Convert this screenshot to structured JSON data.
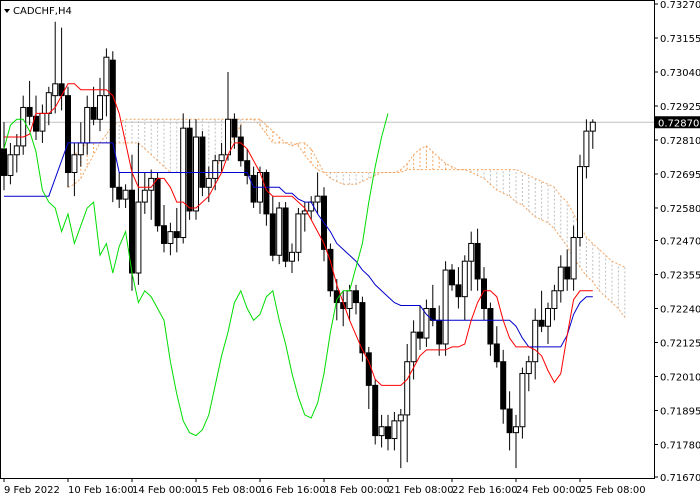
{
  "chart_data": {
    "type": "candlestick",
    "symbol_label": "CADCHF,H4",
    "current_price": "0.72870",
    "ylim": [
      0.7167,
      0.7327
    ],
    "y_ticks": [
      "0.73270",
      "0.73155",
      "0.73040",
      "0.72925",
      "0.72810",
      "0.72695",
      "0.72580",
      "0.72470",
      "0.72355",
      "0.72240",
      "0.72125",
      "0.72010",
      "0.71895",
      "0.71780",
      "0.71670"
    ],
    "x_ticks": [
      "9 Feb 2022",
      "10 Feb 16:00",
      "14 Feb 00:00",
      "15 Feb 08:00",
      "16 Feb 16:00",
      "18 Feb 00:00",
      "21 Feb 08:00",
      "22 Feb 16:00",
      "24 Feb 00:00",
      "25 Feb 08:00"
    ],
    "x_tick_index": [
      0,
      10,
      20,
      30,
      40,
      50,
      60,
      70,
      80,
      90
    ],
    "candles": [
      [
        0.7278,
        0.7287,
        0.7264,
        0.7269
      ],
      [
        0.7269,
        0.728,
        0.7266,
        0.7276
      ],
      [
        0.7276,
        0.7283,
        0.727,
        0.7279
      ],
      [
        0.7279,
        0.7296,
        0.7276,
        0.7292
      ],
      [
        0.7292,
        0.7301,
        0.7286,
        0.7289
      ],
      [
        0.7289,
        0.7296,
        0.7281,
        0.7284
      ],
      [
        0.7284,
        0.7293,
        0.728,
        0.729
      ],
      [
        0.729,
        0.7299,
        0.7286,
        0.7297
      ],
      [
        0.7296,
        0.7321,
        0.729,
        0.73
      ],
      [
        0.73,
        0.7319,
        0.7291,
        0.7296
      ],
      [
        0.7296,
        0.7299,
        0.7265,
        0.727
      ],
      [
        0.727,
        0.728,
        0.7262,
        0.7276
      ],
      [
        0.7276,
        0.7287,
        0.7272,
        0.728
      ],
      [
        0.728,
        0.7296,
        0.7276,
        0.7292
      ],
      [
        0.7292,
        0.7299,
        0.7286,
        0.7288
      ],
      [
        0.7288,
        0.7302,
        0.7284,
        0.7296
      ],
      [
        0.7296,
        0.7312,
        0.7289,
        0.7309
      ],
      [
        0.7308,
        0.7311,
        0.726,
        0.7265
      ],
      [
        0.7265,
        0.727,
        0.7258,
        0.7261
      ],
      [
        0.7261,
        0.7266,
        0.7258,
        0.7264
      ],
      [
        0.7264,
        0.7276,
        0.723,
        0.7236
      ],
      [
        0.7236,
        0.728,
        0.7232,
        0.726
      ],
      [
        0.726,
        0.727,
        0.7256,
        0.7264
      ],
      [
        0.7264,
        0.7271,
        0.7254,
        0.7268
      ],
      [
        0.7268,
        0.727,
        0.725,
        0.7252
      ],
      [
        0.7252,
        0.7259,
        0.7243,
        0.7246
      ],
      [
        0.7246,
        0.7253,
        0.7242,
        0.725
      ],
      [
        0.725,
        0.7258,
        0.7243,
        0.7248
      ],
      [
        0.7248,
        0.729,
        0.7246,
        0.7285
      ],
      [
        0.7285,
        0.7288,
        0.7254,
        0.7257
      ],
      [
        0.7257,
        0.7288,
        0.7254,
        0.7282
      ],
      [
        0.7282,
        0.7284,
        0.7262,
        0.7265
      ],
      [
        0.7265,
        0.7272,
        0.726,
        0.7268
      ],
      [
        0.7268,
        0.7276,
        0.7264,
        0.7274
      ],
      [
        0.7274,
        0.728,
        0.727,
        0.7276
      ],
      [
        0.7276,
        0.7304,
        0.7274,
        0.7288
      ],
      [
        0.7288,
        0.729,
        0.7278,
        0.7282
      ],
      [
        0.7282,
        0.7286,
        0.7272,
        0.7274
      ],
      [
        0.7274,
        0.7278,
        0.7266,
        0.7269
      ],
      [
        0.7269,
        0.7272,
        0.7258,
        0.726
      ],
      [
        0.726,
        0.7272,
        0.7256,
        0.727
      ],
      [
        0.727,
        0.7271,
        0.7252,
        0.7256
      ],
      [
        0.7256,
        0.7262,
        0.724,
        0.7242
      ],
      [
        0.7242,
        0.726,
        0.7239,
        0.7258
      ],
      [
        0.7258,
        0.726,
        0.7238,
        0.724
      ],
      [
        0.724,
        0.7246,
        0.7236,
        0.7243
      ],
      [
        0.7243,
        0.7258,
        0.724,
        0.7256
      ],
      [
        0.7256,
        0.726,
        0.725,
        0.7257
      ],
      [
        0.7257,
        0.7262,
        0.7254,
        0.726
      ],
      [
        0.726,
        0.727,
        0.7256,
        0.7262
      ],
      [
        0.7262,
        0.7265,
        0.724,
        0.7244
      ],
      [
        0.7244,
        0.7246,
        0.7228,
        0.723
      ],
      [
        0.723,
        0.7234,
        0.722,
        0.7226
      ],
      [
        0.7226,
        0.723,
        0.7218,
        0.7224
      ],
      [
        0.7224,
        0.7232,
        0.722,
        0.723
      ],
      [
        0.723,
        0.7232,
        0.7222,
        0.7226
      ],
      [
        0.7226,
        0.7228,
        0.7206,
        0.7209
      ],
      [
        0.7209,
        0.7211,
        0.719,
        0.7198
      ],
      [
        0.7198,
        0.72,
        0.7178,
        0.7181
      ],
      [
        0.7181,
        0.7188,
        0.7177,
        0.7184
      ],
      [
        0.7184,
        0.7188,
        0.7176,
        0.718
      ],
      [
        0.718,
        0.7189,
        0.7176,
        0.7186
      ],
      [
        0.7186,
        0.719,
        0.717,
        0.7188
      ],
      [
        0.7188,
        0.7212,
        0.7172,
        0.7206
      ],
      [
        0.7206,
        0.722,
        0.72,
        0.7216
      ],
      [
        0.7216,
        0.7225,
        0.721,
        0.7214
      ],
      [
        0.7214,
        0.7227,
        0.7211,
        0.7224
      ],
      [
        0.7224,
        0.7232,
        0.7218,
        0.722
      ],
      [
        0.722,
        0.7225,
        0.7208,
        0.7212
      ],
      [
        0.7212,
        0.724,
        0.7208,
        0.7237
      ],
      [
        0.7237,
        0.7239,
        0.723,
        0.7232
      ],
      [
        0.7232,
        0.7238,
        0.7224,
        0.7228
      ],
      [
        0.7228,
        0.7242,
        0.722,
        0.724
      ],
      [
        0.724,
        0.725,
        0.723,
        0.7246
      ],
      [
        0.7246,
        0.7251,
        0.723,
        0.7234
      ],
      [
        0.7234,
        0.7238,
        0.722,
        0.7224
      ],
      [
        0.7224,
        0.7226,
        0.7208,
        0.7212
      ],
      [
        0.7212,
        0.7218,
        0.7204,
        0.7206
      ],
      [
        0.7206,
        0.721,
        0.7185,
        0.719
      ],
      [
        0.719,
        0.7196,
        0.7176,
        0.7182
      ],
      [
        0.7182,
        0.7188,
        0.717,
        0.7184
      ],
      [
        0.7184,
        0.7204,
        0.718,
        0.7202
      ],
      [
        0.7202,
        0.7208,
        0.7196,
        0.7206
      ],
      [
        0.7206,
        0.7224,
        0.72,
        0.722
      ],
      [
        0.722,
        0.723,
        0.7216,
        0.7218
      ],
      [
        0.7218,
        0.7226,
        0.7212,
        0.7224
      ],
      [
        0.7224,
        0.7232,
        0.722,
        0.723
      ],
      [
        0.723,
        0.7242,
        0.7226,
        0.7238
      ],
      [
        0.7238,
        0.7244,
        0.723,
        0.7234
      ],
      [
        0.7234,
        0.7252,
        0.723,
        0.7248
      ],
      [
        0.7248,
        0.7276,
        0.7245,
        0.7272
      ],
      [
        0.7272,
        0.7288,
        0.7268,
        0.7284
      ],
      [
        0.7284,
        0.7288,
        0.7278,
        0.7287
      ]
    ],
    "tenkan_sen": [
      0.7282,
      0.7282,
      0.7282,
      0.7282,
      0.7283,
      0.729,
      0.729,
      0.729,
      0.7292,
      0.7296,
      0.73,
      0.73,
      0.7298,
      0.7298,
      0.7298,
      0.7298,
      0.7298,
      0.7296,
      0.729,
      0.728,
      0.727,
      0.7265,
      0.7265,
      0.7265,
      0.7268,
      0.7268,
      0.7265,
      0.726,
      0.726,
      0.7258,
      0.7258,
      0.726,
      0.7262,
      0.7266,
      0.727,
      0.7276,
      0.728,
      0.728,
      0.7278,
      0.7274,
      0.727,
      0.7264,
      0.7262,
      0.7262,
      0.7262,
      0.7262,
      0.726,
      0.7258,
      0.7254,
      0.725,
      0.7246,
      0.724,
      0.7232,
      0.7226,
      0.722,
      0.7215,
      0.721,
      0.7206,
      0.72,
      0.7198,
      0.7198,
      0.7198,
      0.7198,
      0.72,
      0.7204,
      0.7208,
      0.721,
      0.721,
      0.721,
      0.721,
      0.7211,
      0.7211,
      0.7212,
      0.722,
      0.7226,
      0.723,
      0.723,
      0.7228,
      0.722,
      0.7214,
      0.7211,
      0.7211,
      0.7211,
      0.721,
      0.7208,
      0.7203,
      0.7199,
      0.7202,
      0.7215,
      0.7227,
      0.723,
      0.723,
      0.723
    ],
    "kijun_sen": [
      0.7262,
      0.7262,
      0.7262,
      0.7262,
      0.7262,
      0.7262,
      0.7262,
      0.7262,
      0.7268,
      0.7274,
      0.728,
      0.728,
      0.728,
      0.728,
      0.728,
      0.728,
      0.728,
      0.728,
      0.727,
      0.727,
      0.727,
      0.727,
      0.727,
      0.727,
      0.727,
      0.727,
      0.727,
      0.727,
      0.727,
      0.727,
      0.727,
      0.727,
      0.727,
      0.727,
      0.727,
      0.727,
      0.727,
      0.727,
      0.727,
      0.7265,
      0.7265,
      0.7265,
      0.7265,
      0.7265,
      0.7263,
      0.7263,
      0.7261,
      0.726,
      0.726,
      0.7256,
      0.7253,
      0.725,
      0.7246,
      0.7244,
      0.7242,
      0.724,
      0.7237,
      0.7235,
      0.7232,
      0.723,
      0.7228,
      0.7226,
      0.7225,
      0.7225,
      0.7225,
      0.7225,
      0.7222,
      0.722,
      0.722,
      0.722,
      0.722,
      0.722,
      0.722,
      0.722,
      0.722,
      0.722,
      0.722,
      0.722,
      0.722,
      0.722,
      0.7218,
      0.7214,
      0.7211,
      0.7211,
      0.7211,
      0.7211,
      0.7211,
      0.7211,
      0.7215,
      0.7222,
      0.7226,
      0.7228,
      0.7228
    ],
    "chikou_span": [
      0.7278,
      0.7286,
      0.7288,
      0.7288,
      0.7284,
      0.7277,
      0.7264,
      0.726,
      0.7258,
      0.725,
      0.7256,
      0.7246,
      0.7252,
      0.7258,
      0.726,
      0.7242,
      0.7246,
      0.7236,
      0.7245,
      0.725,
      0.7236,
      0.7226,
      0.723,
      0.7228,
      0.7224,
      0.722,
      0.7206,
      0.7195,
      0.7186,
      0.7182,
      0.7181,
      0.7183,
      0.7188,
      0.7198,
      0.7208,
      0.7216,
      0.7226,
      0.723,
      0.7224,
      0.722,
      0.7222,
      0.7228,
      0.723,
      0.722,
      0.7212,
      0.7202,
      0.7194,
      0.7188,
      0.7187,
      0.7192,
      0.7202,
      0.7216,
      0.7227,
      0.723,
      0.723,
      0.7238,
      0.7246,
      0.726,
      0.7272,
      0.7282,
      0.729
    ],
    "senkou_a": [
      0.7275,
      0.7276,
      0.7278,
      0.728,
      0.728,
      0.728,
      0.728,
      0.728,
      0.728,
      0.728,
      0.728,
      0.728,
      0.7278,
      0.7276,
      0.7274,
      0.7272,
      0.727,
      0.727,
      0.727,
      0.7268,
      0.7268,
      0.7268,
      0.7269,
      0.7271,
      0.7275,
      0.7278,
      0.7282,
      0.7286,
      0.7288,
      0.7288,
      0.7288,
      0.7286,
      0.7284,
      0.7282,
      0.728,
      0.7279,
      0.728,
      0.728,
      0.7278,
      0.7274,
      0.727,
      0.7268,
      0.7267,
      0.7266,
      0.7266,
      0.7266,
      0.7267,
      0.7268,
      0.7269,
      0.727,
      0.727,
      0.727,
      0.7271,
      0.7273,
      0.7276,
      0.7278,
      0.7279,
      0.7277,
      0.7275,
      0.7273,
      0.7272,
      0.7271,
      0.7271,
      0.727,
      0.7269,
      0.7268,
      0.7266,
      0.7264,
      0.7263,
      0.7262,
      0.726,
      0.7259,
      0.7257,
      0.7255,
      0.7254,
      0.7253,
      0.7251,
      0.7248,
      0.7245,
      0.7241,
      0.7238,
      0.7235,
      0.7233,
      0.723,
      0.7228,
      0.7226,
      0.7224,
      0.7221
    ],
    "senkou_b": [
      0.7265,
      0.7266,
      0.7268,
      0.7272,
      0.7276,
      0.728,
      0.7283,
      0.7286,
      0.7287,
      0.7288,
      0.7288,
      0.7288,
      0.7288,
      0.7288,
      0.7288,
      0.7288,
      0.7288,
      0.7288,
      0.7288,
      0.7288,
      0.7288,
      0.7288,
      0.7288,
      0.7288,
      0.7288,
      0.7288,
      0.7288,
      0.7288,
      0.7288,
      0.7288,
      0.7286,
      0.7283,
      0.728,
      0.728,
      0.728,
      0.728,
      0.7279,
      0.7276,
      0.7273,
      0.7271,
      0.727,
      0.727,
      0.727,
      0.727,
      0.727,
      0.727,
      0.727,
      0.727,
      0.727,
      0.727,
      0.727,
      0.727,
      0.727,
      0.7271,
      0.7271,
      0.7271,
      0.7271,
      0.7271,
      0.7271,
      0.7271,
      0.7271,
      0.7271,
      0.7271,
      0.7271,
      0.7271,
      0.7271,
      0.7271,
      0.7271,
      0.7271,
      0.7271,
      0.7271,
      0.727,
      0.7269,
      0.7268,
      0.7267,
      0.7266,
      0.7265,
      0.7262,
      0.726,
      0.7256,
      0.7252,
      0.7248,
      0.7246,
      0.7244,
      0.7242,
      0.724,
      0.7239,
      0.7238
    ],
    "colors": {
      "tenkan": "#ff0000",
      "kijun": "#0000cc",
      "chikou": "#00dd00",
      "cloud_bull": "#f4a460",
      "cloud_bear": "#c0c0c0",
      "candle_bull": "#ffffff",
      "candle_bear": "#000000",
      "outline": "#000000",
      "price_line": "#c0c0c0"
    },
    "grid": false
  }
}
